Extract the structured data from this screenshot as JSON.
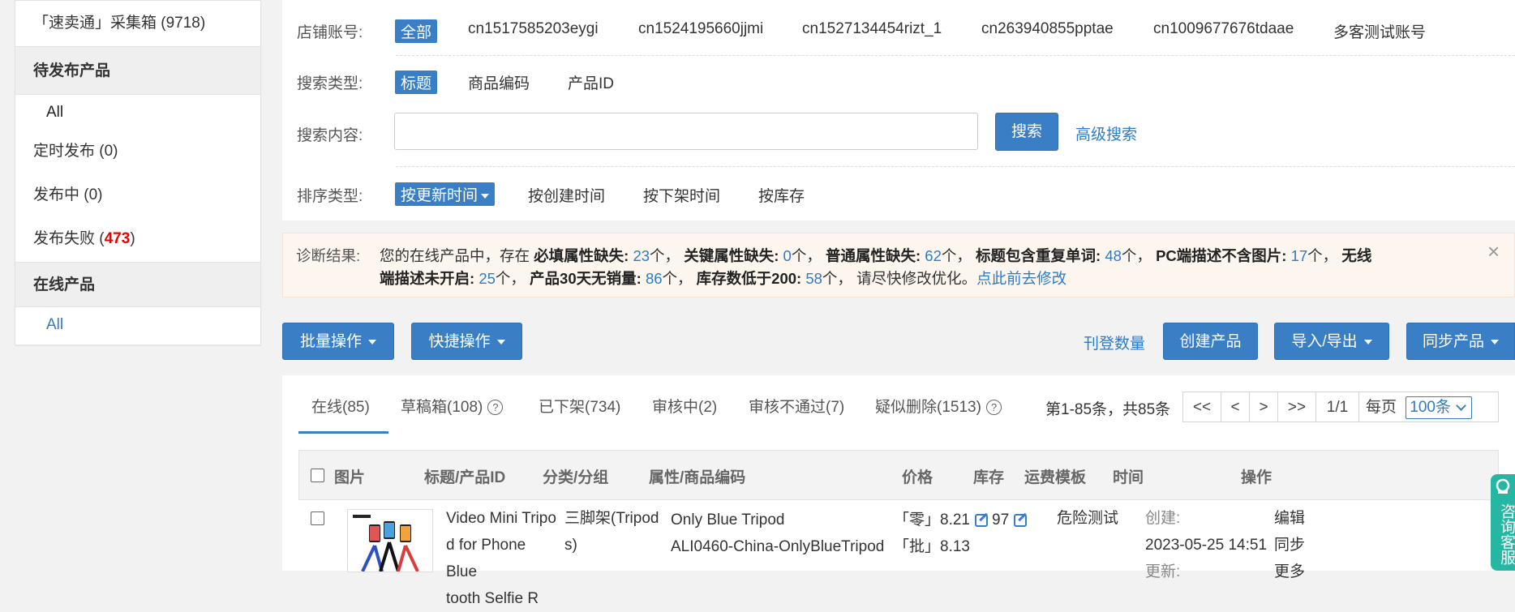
{
  "sidebar": {
    "title": "「速卖通」采集箱 (9718)",
    "section1": "待发布产品",
    "item_all": "All",
    "scheduled": "定时发布 (0)",
    "publishing": "发布中 (0)",
    "failed_prefix": "发布失败 (",
    "failed_count": "473",
    "failed_suffix": ")",
    "section2": "在线产品",
    "online_all": "All"
  },
  "filter": {
    "shop_label": "店铺账号:",
    "shops": [
      "全部",
      "cn1517585203eygi",
      "cn1524195660jjmi",
      "cn1527134454rizt_1",
      "cn263940855pptae",
      "cn1009677676tdaae",
      "多客测试账号"
    ],
    "search_type_label": "搜索类型:",
    "search_types": [
      "标题",
      "商品编码",
      "产品ID"
    ],
    "search_content_label": "搜索内容:",
    "search_value": "",
    "search_button": "搜索",
    "advanced_search": "高级搜索",
    "sort_label": "排序类型:",
    "sorts": [
      "按更新时间",
      "按创建时间",
      "按下架时间",
      "按库存"
    ]
  },
  "diagnosis": {
    "label": "诊断结果:",
    "t1": "您的在线产品中，存在",
    "k1": "必填属性缺失:",
    "v1": "23",
    "u1": "个，",
    "k2": "关键属性缺失:",
    "v2": "0",
    "u2": "个，",
    "k3": "普通属性缺失:",
    "v3": "62",
    "u3": "个，",
    "k4": "标题包含重复单词:",
    "v4": "48",
    "u4": "个，",
    "k5": "PC端描述不含图片:",
    "v5": "17",
    "u5": "个，",
    "k6": "无线端描述未开启:",
    "v6": "25",
    "u6": "个，",
    "k7": "产品30天无销量:",
    "v7": "86",
    "u7": "个，",
    "k8": "库存数低于200:",
    "v8": "58",
    "u8": "个，",
    "tail": "请尽快修改优化。",
    "link": "点此前去修改",
    "close": "×"
  },
  "toolbar": {
    "batch": "批量操作",
    "quick": "快捷操作",
    "listing_count": "刊登数量",
    "create": "创建产品",
    "import_export": "导入/导出",
    "sync": "同步产品"
  },
  "tabs": {
    "online": "在线(85)",
    "draft": "草稿箱(108)",
    "offline": "已下架(734)",
    "reviewing": "审核中(2)",
    "rejected": "审核不通过(7)",
    "suspected_deleted": "疑似删除(1513)",
    "range": "第1-85条，共85条"
  },
  "pager": {
    "first": "<<",
    "prev": "<",
    "next": ">",
    "last": ">>",
    "page": "1/1",
    "per_page_label": "每页",
    "per_page_value": "100条"
  },
  "table": {
    "headers": [
      "图片",
      "标题/产品ID",
      "分类/分组",
      "属性/商品编码",
      "价格",
      "库存",
      "运费模板",
      "时间",
      "操作"
    ],
    "row": {
      "title_l1": "Video Mini Tripo",
      "title_l2": "d for Phone Blue",
      "title_l3": "tooth Selfie R",
      "category_l1": "三脚架(Tripod",
      "category_l2": "s)",
      "attr": "Only Blue Tripod",
      "sku": "ALI0460-China-OnlyBlueTripod",
      "price_retail_tag": "「零」",
      "price_retail": "8.21",
      "price_batch_tag": "「批」",
      "price_batch": "8.13",
      "stock": "97",
      "shipping": "危险测试",
      "created_label": "创建:",
      "created_time": "2023-05-25 14:51",
      "updated_label": "更新:",
      "op_edit": "编辑",
      "op_sync": "同步",
      "op_more": "更多"
    }
  },
  "service": "咨询客服",
  "colors": {
    "accent": "#3a7fc5",
    "danger": "#ee0000",
    "service": "#26b7a4"
  }
}
